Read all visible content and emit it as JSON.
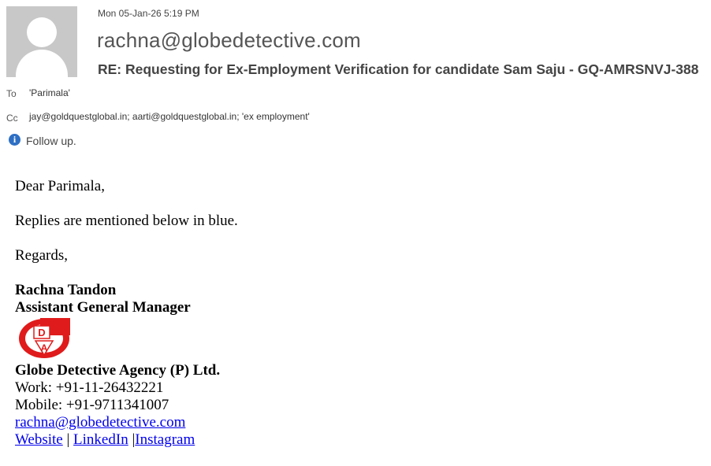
{
  "header": {
    "date": "Mon 05-Jan-26 5:19 PM",
    "sender": "rachna@globedetective.com",
    "subject": "RE: Requesting for Ex-Employment Verification for candidate Sam Saju - GQ-AMRSNVJ-388",
    "to_label": "To",
    "to_value": "'Parimala'",
    "cc_label": "Cc",
    "cc_value": "jay@goldquestglobal.in; aarti@goldquestglobal.in; 'ex employment'",
    "info_icon": "info-icon",
    "info_text": "Follow up."
  },
  "body": {
    "greeting": "Dear Parimala,",
    "line1": "Replies are mentioned below in blue.",
    "regards": "Regards,",
    "signature": {
      "name": "Rachna Tandon",
      "title": "Assistant General Manager",
      "logo_letters": "GDA",
      "company": "Globe Detective Agency (P) Ltd.",
      "work": "Work: +91-11-26432221",
      "mobile": "Mobile: +91-9711341007",
      "email_link": "rachna@globedetective.com",
      "links": {
        "website": "Website",
        "sep1": " | ",
        "linkedin": "LinkedIn",
        "sep2": " |",
        "instagram": "Instagram"
      }
    }
  },
  "colors": {
    "link": "#0000ee",
    "logo_red": "#e01b1b",
    "info_blue": "#2e6fc4"
  }
}
